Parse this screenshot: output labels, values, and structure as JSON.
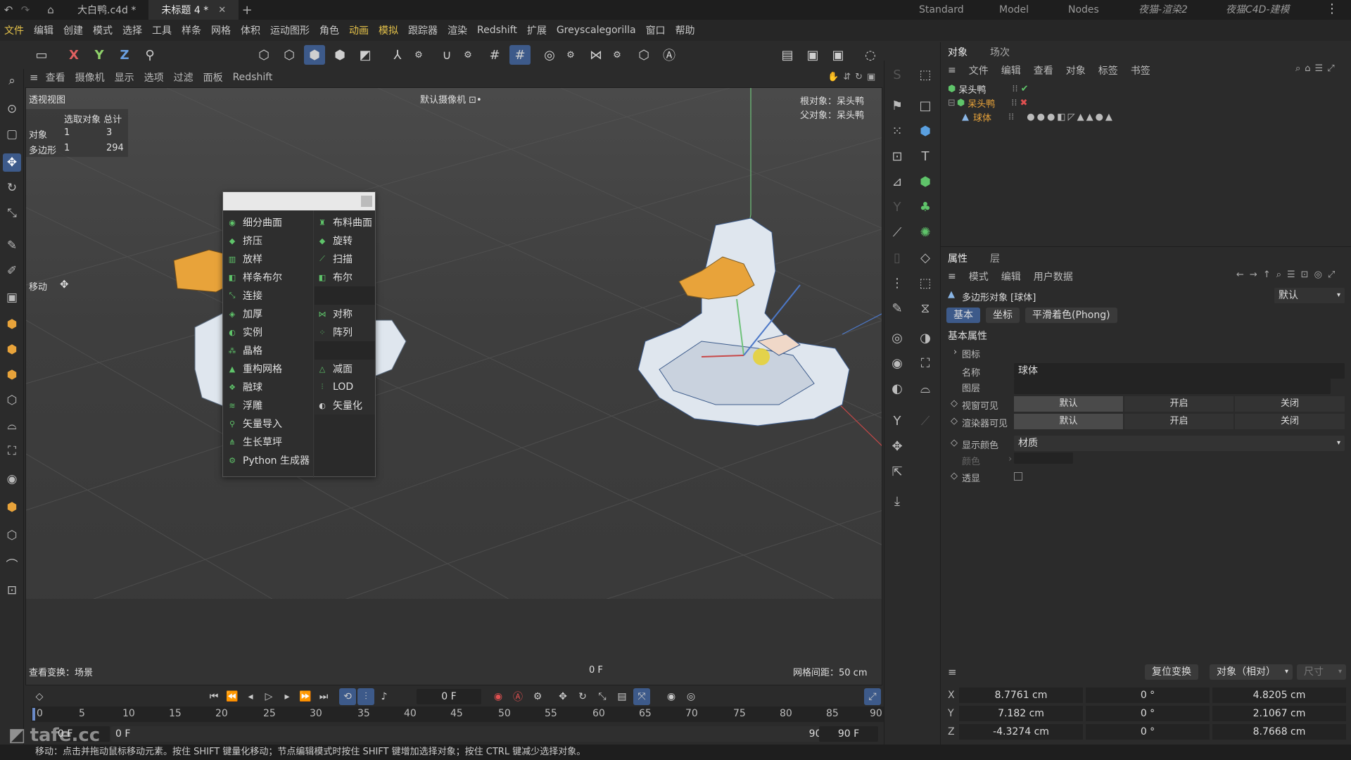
{
  "titlebar": {
    "tabs": [
      {
        "label": "大白鸭.c4d *"
      },
      {
        "label": "未标题 4 *"
      }
    ],
    "add_tab": "+",
    "layouts": [
      "Standard",
      "Model",
      "Nodes",
      "夜猫-渲染2",
      "夜猫C4D-建模"
    ]
  },
  "menubar": [
    "文件",
    "编辑",
    "创建",
    "模式",
    "选择",
    "工具",
    "样条",
    "网格",
    "体积",
    "运动图形",
    "角色",
    "动画",
    "模拟",
    "跟踪器",
    "渲染",
    "Redshift",
    "扩展",
    "Greyscalegorilla",
    "窗口",
    "帮助"
  ],
  "toolbar": {
    "axis_x": "X",
    "axis_y": "Y",
    "axis_z": "Z"
  },
  "viewport_menu": [
    "查看",
    "摄像机",
    "显示",
    "选项",
    "过滤",
    "面板",
    "Redshift"
  ],
  "viewport": {
    "title": "透视视图",
    "camera": "默认摄像机 ⊡•",
    "stats_header": "选取对象 总计",
    "stats": [
      {
        "label": "对象",
        "selected": "1",
        "total": "3"
      },
      {
        "label": "多边形",
        "selected": "1",
        "total": "294"
      }
    ],
    "root_object": "根对象：呆头鸭",
    "parent_object": "父对象：呆头鸭",
    "move_label": "移动",
    "view_transform": "查看变换：场景",
    "frame": "0 F",
    "grid_spacing": "网格间距：50 cm"
  },
  "popup": {
    "left": [
      "细分曲面",
      "挤压",
      "放样",
      "样条布尔",
      "连接",
      "加厚",
      "实例",
      "晶格",
      "重构网格",
      "融球",
      "浮雕",
      "矢量导入",
      "生长草坪",
      "Python 生成器"
    ],
    "right": [
      "布料曲面",
      "旋转",
      "扫描",
      "布尔",
      "",
      "对称",
      "阵列",
      "",
      "减面",
      "LOD",
      "矢量化"
    ]
  },
  "object_panel": {
    "tabs": [
      "对象",
      "场次"
    ],
    "menu": [
      "文件",
      "编辑",
      "查看",
      "对象",
      "标签",
      "书签"
    ],
    "objects": [
      {
        "name": "呆头鸭",
        "color": "#e0e0e0"
      },
      {
        "name": "呆头鸭",
        "color": "#e8a33a"
      },
      {
        "name": "球体",
        "color": "#e8a33a"
      }
    ]
  },
  "attr_panel": {
    "tabs": [
      "属性",
      "层"
    ],
    "menu": [
      "模式",
      "编辑",
      "用户数据"
    ],
    "object_title": "多边形对象 [球体]",
    "preset": "默认",
    "sub_tabs": [
      "基本",
      "坐标",
      "平滑着色(Phong)"
    ],
    "section": "基本属性",
    "icon_label": "图标",
    "name_label": "名称",
    "name_value": "球体",
    "layer_label": "图层",
    "editor_visible": "视窗可见",
    "render_visible": "渲染器可见",
    "seg_default": "默认",
    "seg_on": "开启",
    "seg_off": "关闭",
    "display_color": "显示颜色",
    "display_color_value": "材质",
    "color_label": "颜色",
    "xray_label": "透显"
  },
  "coords": {
    "reset_btn": "复位变换",
    "mode": "对象（相对）",
    "size_label": "尺寸",
    "rows": [
      {
        "axis": "X",
        "pos": "8.7761 cm",
        "rot": "0 °",
        "size": "4.8205 cm"
      },
      {
        "axis": "Y",
        "pos": "7.182 cm",
        "rot": "0 °",
        "size": "2.1067 cm"
      },
      {
        "axis": "Z",
        "pos": "-4.3274 cm",
        "rot": "0 °",
        "size": "8.7668 cm"
      }
    ]
  },
  "timeline": {
    "current_frame": "0 F",
    "ticks": [
      "0",
      "5",
      "10",
      "15",
      "20",
      "25",
      "30",
      "35",
      "40",
      "45",
      "50",
      "55",
      "60",
      "65",
      "70",
      "75",
      "80",
      "85",
      "90"
    ],
    "start": "0 F",
    "start2": "0 F",
    "end": "90 F",
    "end2": "90 F"
  },
  "statusbar": "移动：点击并拖动鼠标移动元素。按住 SHIFT 键量化移动；节点编辑模式时按住 SHIFT 键增加选择对象；按住 CTRL 键减少选择对象。",
  "watermark": "tafe.cc",
  "colors": {
    "accent": "#3d5a8a",
    "highlight": "#e6c34a",
    "duck_body": "#dfe6ee",
    "duck_beak": "#e8a33a"
  }
}
